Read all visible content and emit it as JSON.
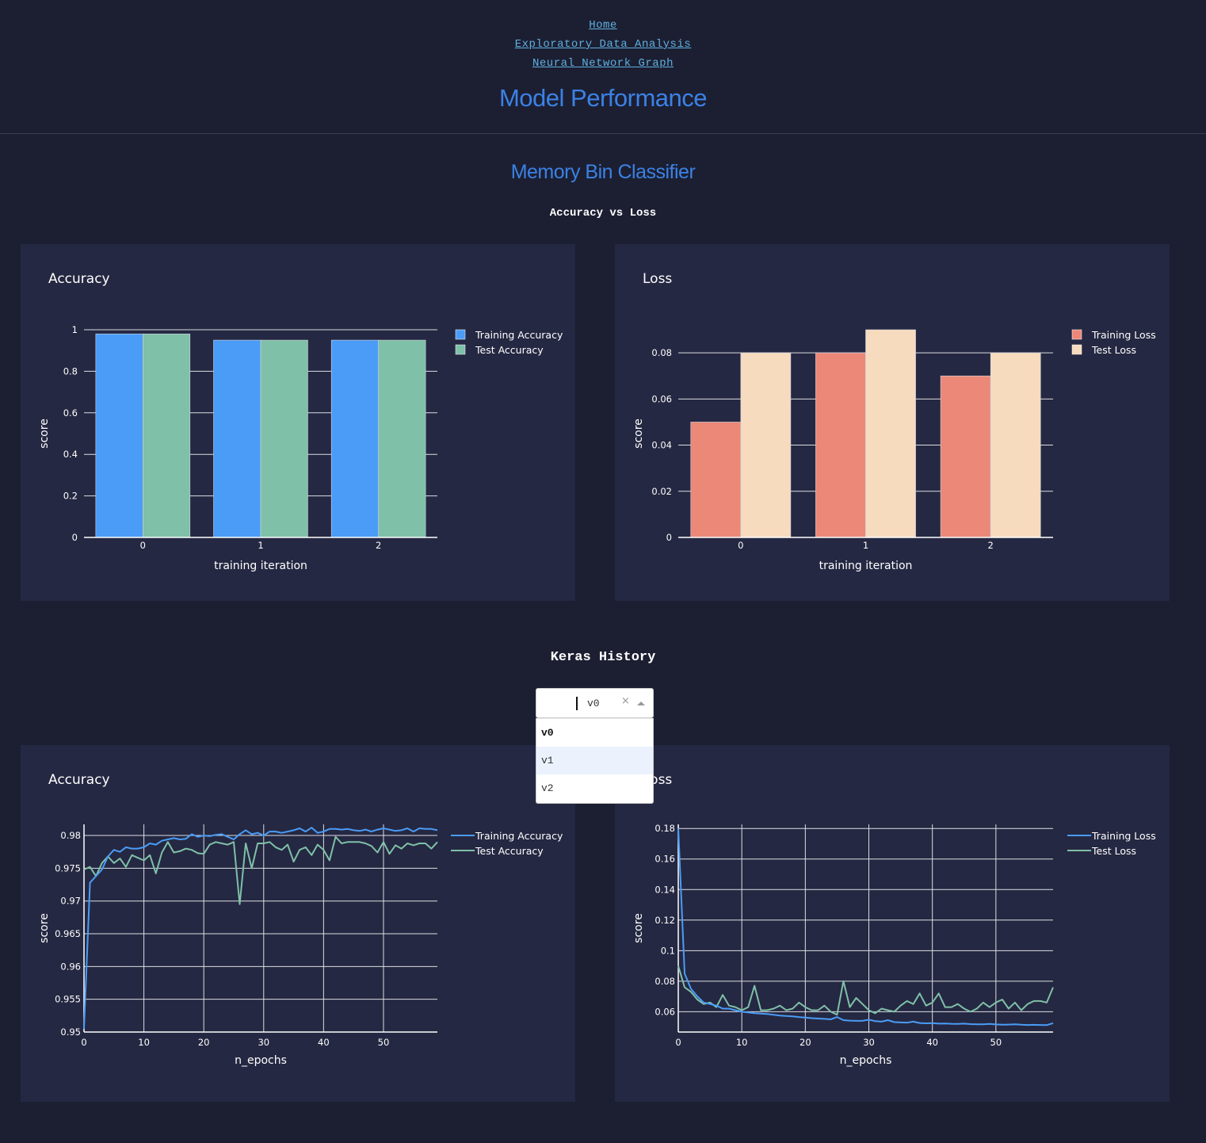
{
  "nav": {
    "links": [
      "Home",
      "Exploratory Data Analysis",
      "Neural Network Graph"
    ]
  },
  "page_title": "Model Performance",
  "classifier_title": "Memory Bin Classifier",
  "sections": {
    "acc_vs_loss": "Accuracy vs Loss",
    "keras_history": "Keras History"
  },
  "dropdown": {
    "value": "v0",
    "clear_icon": "×",
    "options": [
      "v0",
      "v1",
      "v2"
    ],
    "selected": "v0",
    "highlighted": "v1"
  },
  "colors": {
    "background": "#1c1f32",
    "panel": "#252842",
    "title_blue": "#3b82e6",
    "link": "#5fb0e0",
    "training_accuracy": "#4a9cf7",
    "test_accuracy": "#7fc0a8",
    "training_loss": "#eb8878",
    "test_loss": "#f7dbbe"
  },
  "chart_data": [
    {
      "id": "bar-acc",
      "type": "bar",
      "title": "Accuracy",
      "xlabel": "training iteration",
      "ylabel": "score",
      "categories": [
        "0",
        "1",
        "2"
      ],
      "ylim": [
        0,
        1
      ],
      "yticks": [
        0,
        0.2,
        0.4,
        0.6,
        0.8,
        1
      ],
      "yticklabels": [
        "0",
        "0.2",
        "0.4",
        "0.6",
        "0.8",
        "1"
      ],
      "legend_position": "top-right",
      "series": [
        {
          "name": "Training Accuracy",
          "color": "#4a9cf7",
          "values": [
            0.98,
            0.95,
            0.95
          ]
        },
        {
          "name": "Test Accuracy",
          "color": "#7fc0a8",
          "values": [
            0.98,
            0.95,
            0.95
          ]
        }
      ]
    },
    {
      "id": "bar-loss",
      "type": "bar",
      "title": "Loss",
      "xlabel": "training iteration",
      "ylabel": "score",
      "categories": [
        "0",
        "1",
        "2"
      ],
      "ylim": [
        0,
        0.09
      ],
      "yticks": [
        0,
        0.02,
        0.04,
        0.06,
        0.08
      ],
      "yticklabels": [
        "0",
        "0.02",
        "0.04",
        "0.06",
        "0.08"
      ],
      "legend_position": "top-right",
      "series": [
        {
          "name": "Training Loss",
          "color": "#eb8878",
          "values": [
            0.05,
            0.08,
            0.07
          ]
        },
        {
          "name": "Test Loss",
          "color": "#f7dbbe",
          "values": [
            0.08,
            0.09,
            0.08
          ]
        }
      ]
    },
    {
      "id": "line-acc",
      "type": "line",
      "title": "Accuracy",
      "xlabel": "n_epochs",
      "ylabel": "score",
      "xlim": [
        0,
        59
      ],
      "ylim": [
        0.95,
        0.9817
      ],
      "xticks": [
        0,
        10,
        20,
        30,
        40,
        50
      ],
      "yticks": [
        0.95,
        0.955,
        0.96,
        0.965,
        0.97,
        0.975,
        0.98
      ],
      "yticklabels": [
        "0.95",
        "0.955",
        "0.96",
        "0.965",
        "0.97",
        "0.975",
        "0.98"
      ],
      "legend_position": "top-right",
      "series": [
        {
          "name": "Training Accuracy",
          "color": "#4a9cf7",
          "x_start": 0,
          "values": [
            0.9505,
            0.9728,
            0.9738,
            0.9748,
            0.9768,
            0.9778,
            0.9775,
            0.9782,
            0.978,
            0.978,
            0.9782,
            0.9788,
            0.9786,
            0.9792,
            0.9794,
            0.9796,
            0.9794,
            0.9795,
            0.9802,
            0.9798,
            0.98,
            0.9799,
            0.9801,
            0.9802,
            0.9798,
            0.9794,
            0.9802,
            0.9808,
            0.9802,
            0.9804,
            0.98,
            0.9806,
            0.9806,
            0.9804,
            0.9806,
            0.9808,
            0.9811,
            0.9806,
            0.9812,
            0.9804,
            0.9806,
            0.981,
            0.981,
            0.9809,
            0.981,
            0.9808,
            0.9807,
            0.9809,
            0.9806,
            0.9809,
            0.9811,
            0.9809,
            0.9807,
            0.9808,
            0.9811,
            0.9806,
            0.9811,
            0.981,
            0.981,
            0.9808
          ]
        },
        {
          "name": "Test Accuracy",
          "color": "#7fc0a8",
          "x_start": 0,
          "values": [
            0.9748,
            0.9752,
            0.9738,
            0.9758,
            0.9768,
            0.9758,
            0.9765,
            0.9752,
            0.977,
            0.9766,
            0.9762,
            0.977,
            0.9742,
            0.9774,
            0.979,
            0.9774,
            0.9776,
            0.978,
            0.9778,
            0.9773,
            0.9772,
            0.9786,
            0.979,
            0.9788,
            0.9786,
            0.979,
            0.9695,
            0.9788,
            0.975,
            0.9788,
            0.9788,
            0.979,
            0.9782,
            0.9778,
            0.9786,
            0.976,
            0.9778,
            0.9782,
            0.977,
            0.9786,
            0.9778,
            0.9762,
            0.9798,
            0.9788,
            0.979,
            0.979,
            0.979,
            0.9788,
            0.9784,
            0.9774,
            0.979,
            0.9772,
            0.9785,
            0.978,
            0.9788,
            0.9785,
            0.9788,
            0.9788,
            0.978,
            0.979
          ]
        }
      ]
    },
    {
      "id": "line-loss",
      "type": "line",
      "title": "Loss",
      "xlabel": "n_epochs",
      "ylabel": "score",
      "xlim": [
        0,
        59
      ],
      "ylim": [
        0.0467,
        0.1827
      ],
      "xticks": [
        0,
        10,
        20,
        30,
        40,
        50
      ],
      "yticks": [
        0.06,
        0.08,
        0.1,
        0.12,
        0.14,
        0.16,
        0.18
      ],
      "yticklabels": [
        "0.06",
        "0.08",
        "0.1",
        "0.12",
        "0.14",
        "0.16",
        "0.18"
      ],
      "legend_position": "top-right",
      "series": [
        {
          "name": "Training Loss",
          "color": "#4a9cf7",
          "x_start": 0,
          "values": [
            0.18,
            0.085,
            0.075,
            0.07,
            0.066,
            0.065,
            0.064,
            0.062,
            0.062,
            0.061,
            0.06,
            0.0595,
            0.059,
            0.0588,
            0.0585,
            0.058,
            0.0575,
            0.0572,
            0.057,
            0.0565,
            0.0562,
            0.0558,
            0.0555,
            0.0553,
            0.055,
            0.0565,
            0.0545,
            0.0542,
            0.054,
            0.054,
            0.0548,
            0.0538,
            0.0535,
            0.0545,
            0.0532,
            0.053,
            0.0528,
            0.0535,
            0.0526,
            0.0524,
            0.0525,
            0.0522,
            0.0523,
            0.0521,
            0.052,
            0.0522,
            0.0519,
            0.0518,
            0.0518,
            0.052,
            0.0517,
            0.0515,
            0.0516,
            0.0518,
            0.0515,
            0.0513,
            0.0514,
            0.0513,
            0.0512,
            0.0525
          ]
        },
        {
          "name": "Test Loss",
          "color": "#7fc0a8",
          "x_start": 0,
          "values": [
            0.09,
            0.076,
            0.073,
            0.068,
            0.065,
            0.066,
            0.063,
            0.071,
            0.064,
            0.063,
            0.061,
            0.063,
            0.077,
            0.061,
            0.061,
            0.062,
            0.064,
            0.061,
            0.062,
            0.066,
            0.063,
            0.061,
            0.061,
            0.064,
            0.06,
            0.058,
            0.08,
            0.063,
            0.069,
            0.065,
            0.061,
            0.059,
            0.062,
            0.061,
            0.06,
            0.064,
            0.067,
            0.065,
            0.072,
            0.064,
            0.066,
            0.072,
            0.063,
            0.063,
            0.065,
            0.062,
            0.06,
            0.062,
            0.066,
            0.063,
            0.066,
            0.068,
            0.062,
            0.066,
            0.061,
            0.065,
            0.067,
            0.067,
            0.066,
            0.076
          ]
        }
      ]
    }
  ]
}
